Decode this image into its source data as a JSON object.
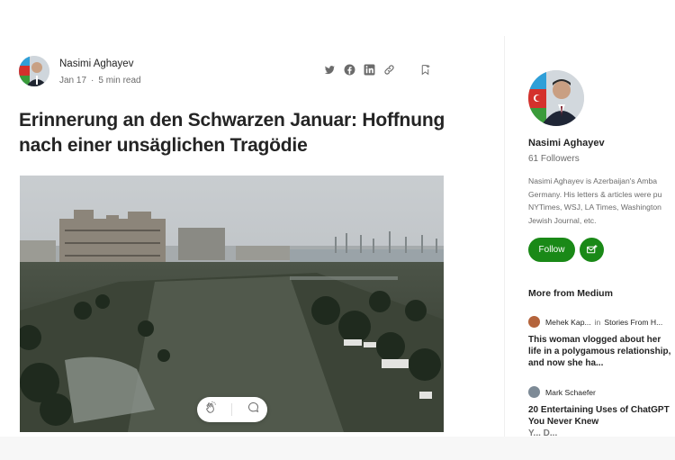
{
  "article": {
    "author_name": "Nasimi Aghayev",
    "date": "Jan 17",
    "read_time": "5 min read",
    "title": "Erinnerung an den Schwarzen Januar: Hoffnung nach einer unsäglichen Tragödie"
  },
  "share_icons": [
    "twitter-icon",
    "facebook-icon",
    "linkedin-icon",
    "link-icon",
    "bookmark-add-icon"
  ],
  "engagement": {
    "icons": [
      "clap-icon",
      "comment-icon"
    ]
  },
  "sidebar": {
    "author_name": "Nasimi Aghayev",
    "followers": "61 Followers",
    "bio_lines": [
      "Nasimi Aghayev is Azerbaijan's Amba",
      "Germany. His letters & articles were pu",
      "NYTimes, WSJ, LA Times, Washington",
      "Jewish Journal, etc."
    ],
    "follow_label": "Follow",
    "more_heading": "More from Medium",
    "stories": [
      {
        "author": "Mehek Kap...",
        "in_label": "in",
        "publication": "Stories From H...",
        "title": "This woman vlogged about her life in a polygamous relationship, and now she ha..."
      },
      {
        "author": "Mark Schaefer",
        "title": "20 Entertaining Uses of ChatGPT You Never Knew",
        "title_cut": "Y... D..."
      }
    ]
  },
  "colors": {
    "accent": "#1a8917",
    "text": "#242424",
    "muted": "#6b6b6b"
  }
}
